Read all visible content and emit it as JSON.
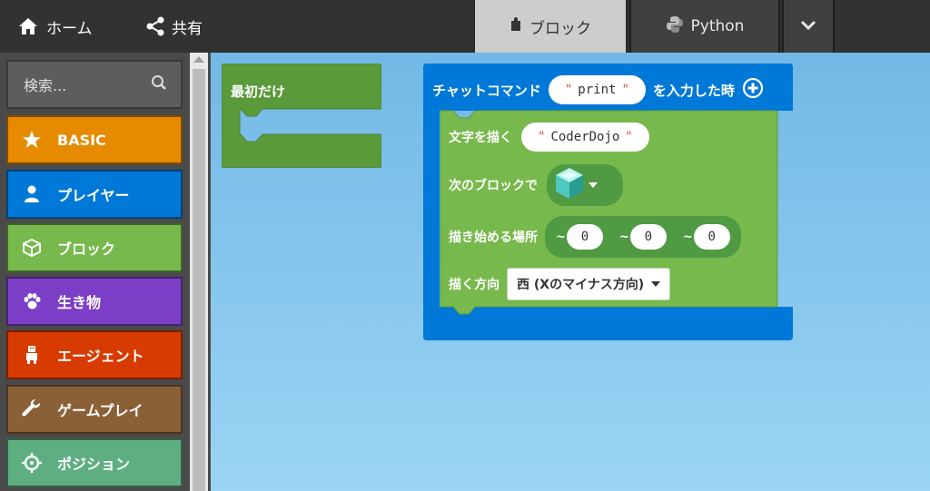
{
  "topbar": {
    "home_label": "ホーム",
    "share_label": "共有",
    "tabs": {
      "blocks_label": "ブロック",
      "python_label": "Python"
    }
  },
  "toolbox": {
    "search_placeholder": "検索...",
    "categories": [
      {
        "label": "BASIC",
        "icon": "star-icon",
        "color": "#e68a00"
      },
      {
        "label": "プレイヤー",
        "icon": "person-icon",
        "color": "#0078d7"
      },
      {
        "label": "ブロック",
        "icon": "cube-icon",
        "color": "#77b94c"
      },
      {
        "label": "生き物",
        "icon": "paw-icon",
        "color": "#7d3ec7"
      },
      {
        "label": "エージェント",
        "icon": "robot-icon",
        "color": "#d83b01"
      },
      {
        "label": "ゲームプレイ",
        "icon": "wrench-icon",
        "color": "#8a6037"
      },
      {
        "label": "ポジション",
        "icon": "crosshair-icon",
        "color": "#5fae82"
      }
    ]
  },
  "workspace": {
    "once_block": {
      "title": "最初だけ",
      "color": "#5a9a3a"
    },
    "chat_block": {
      "color": "#0078d7",
      "prefix": "チャットコマンド",
      "command_value": "print",
      "suffix": "を入力した時",
      "inner": {
        "color": "#77b94c",
        "text_label": "文字を描く",
        "text_value": "CoderDojo",
        "block_label": "次のブロックで",
        "block_value_icon": "diamond-block-icon",
        "start_label": "描き始める場所",
        "coords": [
          "0",
          "0",
          "0"
        ],
        "direction_label": "描く方向",
        "direction_value": "西 (Xのマイナス方向)"
      }
    }
  }
}
